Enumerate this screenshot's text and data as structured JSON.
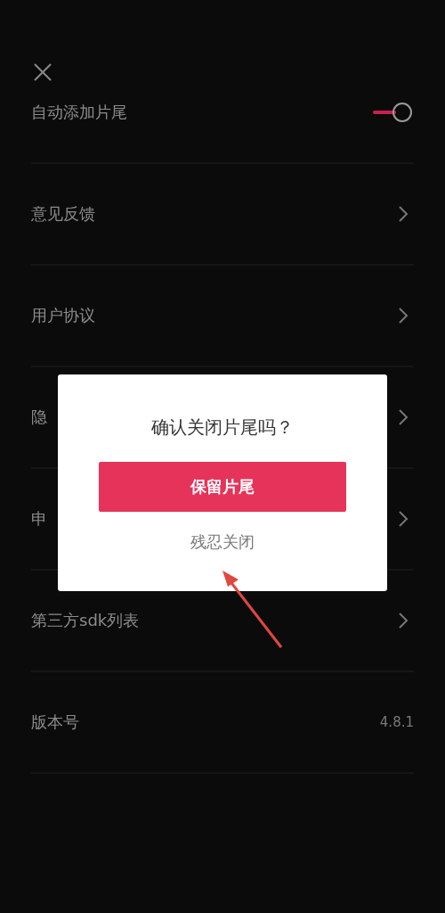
{
  "settings": [
    {
      "kind": "toggle",
      "label": "自动添加片尾",
      "on": true
    },
    {
      "kind": "link",
      "label": "意见反馈"
    },
    {
      "kind": "link",
      "label": "用户协议"
    },
    {
      "kind": "link",
      "label": "隐"
    },
    {
      "kind": "link",
      "label": "申"
    },
    {
      "kind": "link",
      "label": "第三方sdk列表"
    },
    {
      "kind": "value",
      "label": "版本号",
      "value": "4.8.1"
    }
  ],
  "dialog": {
    "title": "确认关闭片尾吗？",
    "primary_button": "保留片尾",
    "secondary_button": "残忍关闭"
  }
}
